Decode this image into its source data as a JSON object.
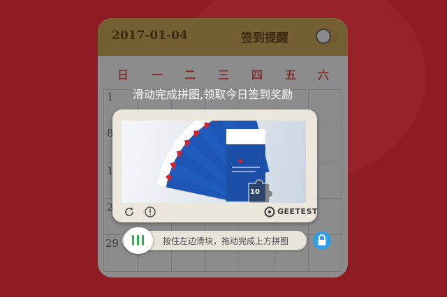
{
  "calendar": {
    "date": "2017-01-04",
    "sign_title": "签到提醒",
    "toggle_state": "off",
    "weekdays": [
      "日",
      "一",
      "二",
      "三",
      "四",
      "五",
      "六"
    ],
    "day_numbers": [
      "1",
      "8",
      "1",
      "2",
      "29"
    ]
  },
  "captcha": {
    "title": "滑动完成拼图,领取今日签到奖励",
    "brand": "GEETEST",
    "product_badge": "10",
    "slider_hint": "按住左边滑块，拖动完成上方拼图",
    "icons": [
      "refresh-icon",
      "info-icon",
      "geetest-logo-icon",
      "slider-grip-icon",
      "lock-icon"
    ],
    "colors": {
      "slider_accent": "#2fb24a",
      "lock_blue": "#2f9ee4",
      "product_blue": "#1d56b4"
    }
  }
}
